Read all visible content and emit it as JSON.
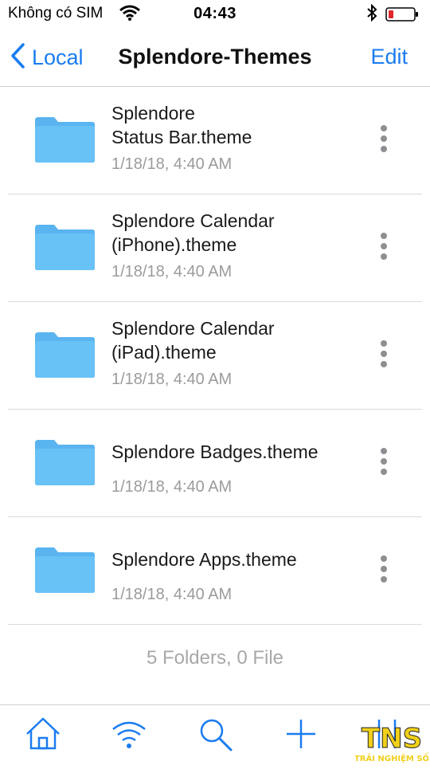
{
  "status_bar": {
    "carrier": "Không có SIM",
    "time": "04:43",
    "wifi_icon": "wifi-icon",
    "bluetooth_icon": "bluetooth-icon",
    "battery_icon": "battery-low-icon",
    "battery_color": "#e0262b"
  },
  "nav": {
    "back_label": "Local",
    "title": "Splendore-Themes",
    "edit_label": "Edit",
    "accent": "#1a7cf0"
  },
  "items": [
    {
      "name_line1": "Splendore",
      "name_line2": "Status Bar.theme",
      "date": "1/18/18, 4:40 AM"
    },
    {
      "name_line1": "Splendore Calendar",
      "name_line2": "(iPhone).theme",
      "date": "1/18/18, 4:40 AM"
    },
    {
      "name_line1": "Splendore Calendar",
      "name_line2": "(iPad).theme",
      "date": "1/18/18, 4:40 AM"
    },
    {
      "name_line1": "Splendore Badges.theme",
      "name_line2": "",
      "date": "1/18/18, 4:40 AM"
    },
    {
      "name_line1": "Splendore Apps.theme",
      "name_line2": "",
      "date": "1/18/18, 4:40 AM"
    }
  ],
  "summary": "5 Folders, 0 File",
  "toolbar": {
    "icons": [
      "home-icon",
      "wifi-transfer-icon",
      "search-icon",
      "add-icon",
      "sort-icon"
    ]
  },
  "watermark": {
    "logo_letters": "TNS",
    "tagline": "TRẢI NGHIỆM SỐ"
  }
}
